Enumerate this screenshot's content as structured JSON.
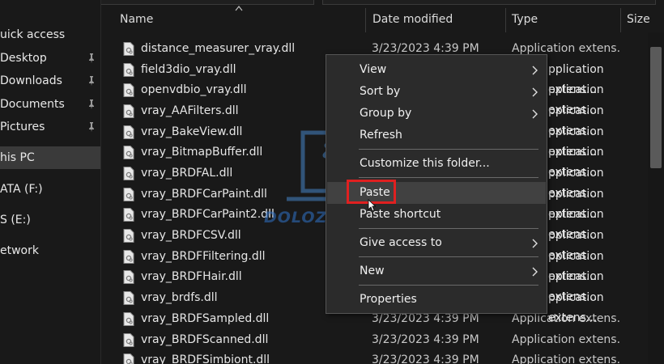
{
  "navigation": {
    "items": [
      {
        "label": "uick access",
        "pinned": false,
        "selected": false,
        "icon": "star-icon"
      },
      {
        "label": "Desktop",
        "pinned": true,
        "selected": false,
        "icon": "desktop-icon"
      },
      {
        "label": "Downloads",
        "pinned": true,
        "selected": false,
        "icon": "download-icon"
      },
      {
        "label": "Documents",
        "pinned": true,
        "selected": false,
        "icon": "document-icon"
      },
      {
        "label": "Pictures",
        "pinned": true,
        "selected": false,
        "icon": "picture-icon"
      },
      {
        "label": "his PC",
        "pinned": false,
        "selected": true,
        "icon": "computer-icon"
      },
      {
        "label": "ATA (F:)",
        "pinned": false,
        "selected": false,
        "icon": "drive-icon"
      },
      {
        "label": "S (E:)",
        "pinned": false,
        "selected": false,
        "icon": "drive-icon"
      },
      {
        "label": "etwork",
        "pinned": false,
        "selected": false,
        "icon": "network-icon"
      }
    ]
  },
  "columns": {
    "name": "Name",
    "date_modified": "Date modified",
    "type": "Type",
    "size": "Size"
  },
  "files": [
    {
      "name": "distance_measurer_vray.dll",
      "date": "3/23/2023 4:39 PM",
      "type": "Application extens..."
    },
    {
      "name": "field3dio_vray.dll",
      "date": "",
      "type": ""
    },
    {
      "name": "openvdbio_vray.dll",
      "date": "",
      "type": ""
    },
    {
      "name": "vray_AAFilters.dll",
      "date": "",
      "type": ""
    },
    {
      "name": "vray_BakeView.dll",
      "date": "",
      "type": ""
    },
    {
      "name": "vray_BitmapBuffer.dll",
      "date": "",
      "type": ""
    },
    {
      "name": "vray_BRDFAL.dll",
      "date": "",
      "type": ""
    },
    {
      "name": "vray_BRDFCarPaint.dll",
      "date": "",
      "type": ""
    },
    {
      "name": "vray_BRDFCarPaint2.dll",
      "date": "",
      "type": ""
    },
    {
      "name": "vray_BRDFCSV.dll",
      "date": "",
      "type": ""
    },
    {
      "name": "vray_BRDFFiltering.dll",
      "date": "",
      "type": ""
    },
    {
      "name": "vray_BRDFHair.dll",
      "date": "",
      "type": ""
    },
    {
      "name": "vray_brdfs.dll",
      "date": "",
      "type": ""
    },
    {
      "name": "vray_BRDFSampled.dll",
      "date": "3/23/2023 4:39 PM",
      "type": "Application extens..."
    },
    {
      "name": "vray_BRDFScanned.dll",
      "date": "3/23/2023 4:39 PM",
      "type": "Application extens..."
    },
    {
      "name": "vray_BRDFSimbiont.dll",
      "date": "3/23/2023 4:39 PM",
      "type": "Application extens..."
    }
  ],
  "partial_type_text": "pplication extens...",
  "context_menu": {
    "items": [
      {
        "label": "View",
        "submenu": true
      },
      {
        "label": "Sort by",
        "submenu": true
      },
      {
        "label": "Group by",
        "submenu": true
      },
      {
        "label": "Refresh",
        "submenu": false
      },
      {
        "label": "Customize this folder...",
        "submenu": false
      },
      {
        "label": "Paste",
        "submenu": false,
        "highlighted": true
      },
      {
        "label": "Paste shortcut",
        "submenu": false
      },
      {
        "label": "Give access to",
        "submenu": true
      },
      {
        "label": "New",
        "submenu": true
      },
      {
        "label": "Properties",
        "submenu": false
      }
    ]
  },
  "watermark_text": "DOLOZI",
  "colors": {
    "background": "#191919",
    "menu_background": "#2b2b2b",
    "menu_hover": "#414141",
    "highlight_box": "#e02020",
    "watermark": "#2f72c8"
  }
}
